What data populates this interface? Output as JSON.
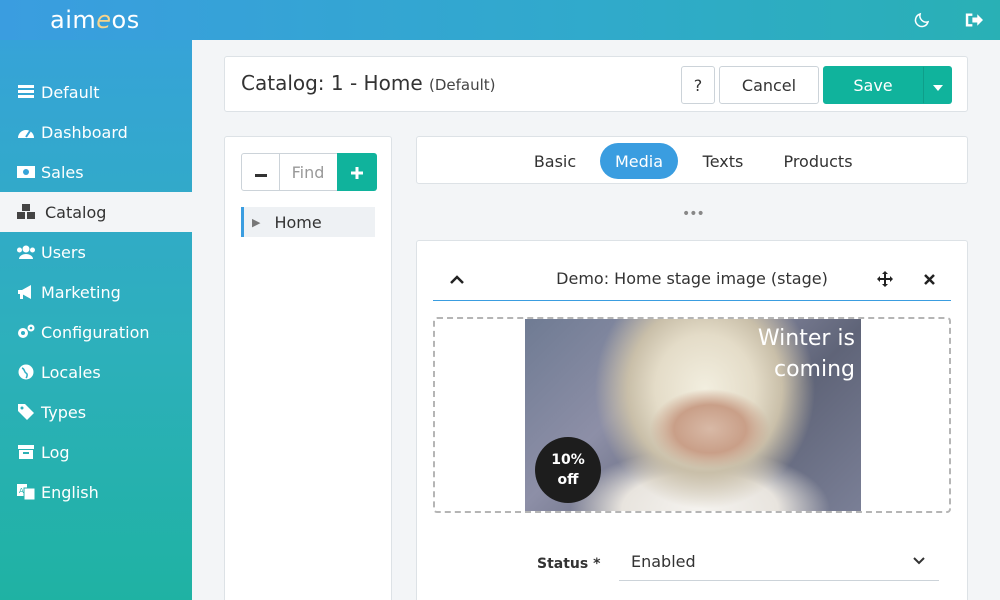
{
  "app": {
    "logo_prefix": "aim",
    "logo_e": "e",
    "logo_suffix": "os"
  },
  "topbar": {
    "theme_icon": "moon-icon",
    "logout_icon": "sign-out-icon"
  },
  "sidebar": {
    "items": [
      {
        "label": "Default",
        "icon": "server-icon"
      },
      {
        "label": "Dashboard",
        "icon": "gauge-icon"
      },
      {
        "label": "Sales",
        "icon": "money-bill-icon"
      },
      {
        "label": "Catalog",
        "icon": "cubes-icon",
        "active": true
      },
      {
        "label": "Users",
        "icon": "users-icon"
      },
      {
        "label": "Marketing",
        "icon": "bullhorn-icon"
      },
      {
        "label": "Configuration",
        "icon": "cogs-icon"
      },
      {
        "label": "Locales",
        "icon": "globe-icon"
      },
      {
        "label": "Types",
        "icon": "tag-icon"
      },
      {
        "label": "Log",
        "icon": "archive-icon"
      },
      {
        "label": "English",
        "icon": "language-icon"
      }
    ]
  },
  "header": {
    "title": "Catalog: 1 - Home",
    "subtitle": "(Default)",
    "help_label": "?",
    "cancel_label": "Cancel",
    "save_label": "Save",
    "save_dropdown_icon": "caret-down-icon"
  },
  "tree": {
    "find_placeholder": "Find",
    "nodes": [
      {
        "label": "Home"
      }
    ]
  },
  "tabs": [
    {
      "label": "Basic"
    },
    {
      "label": "Media",
      "active": true
    },
    {
      "label": "Texts"
    },
    {
      "label": "Products"
    }
  ],
  "media": {
    "item_title": "Demo: Home stage image (stage)",
    "image_text_line1": "Winter is",
    "image_text_line2": "coming",
    "badge_line1": "10%",
    "badge_line2": "off",
    "status_label": "Status *",
    "status_value": "Enabled"
  },
  "colors": {
    "accent": "#3a9de0",
    "save": "#10b39c"
  }
}
